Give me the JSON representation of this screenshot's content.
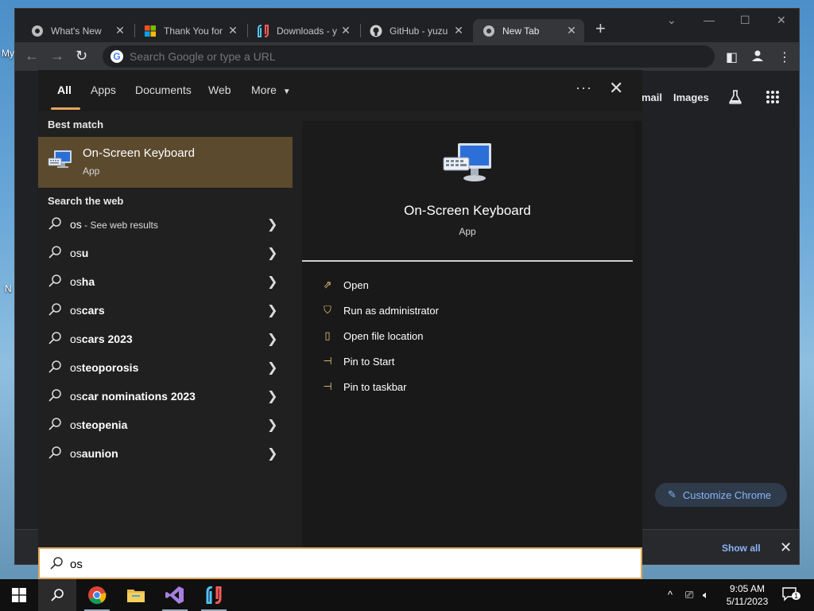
{
  "desktop": {
    "left_glyphs": [
      "My",
      "N"
    ]
  },
  "browser": {
    "tabs": [
      {
        "title": "What's New",
        "icon": "chrome-icon"
      },
      {
        "title": "Thank You for",
        "icon": "microsoft-icon"
      },
      {
        "title": "Downloads - y",
        "icon": "yuzu-icon"
      },
      {
        "title": "GitHub - yuzu",
        "icon": "github-icon"
      },
      {
        "title": "New Tab",
        "icon": "chrome-icon",
        "active": true
      }
    ],
    "new_tab_glyph": "+",
    "omnibox_placeholder": "Search Google or type a URL",
    "ntp": {
      "gmail": "mail",
      "images": "Images",
      "customize": "Customize Chrome"
    },
    "downloads_bar": {
      "show_all": "Show all"
    }
  },
  "search": {
    "filters": [
      "All",
      "Apps",
      "Documents",
      "Web",
      "More"
    ],
    "active_filter": "All",
    "best_match_label": "Best match",
    "best_match": {
      "title": "On-Screen Keyboard",
      "subtitle": "App"
    },
    "web_label": "Search the web",
    "web_results": [
      {
        "typed": "os",
        "rest": "",
        "hint": " - See web results"
      },
      {
        "typed": "os",
        "rest": "u",
        "hint": ""
      },
      {
        "typed": "os",
        "rest": "ha",
        "hint": ""
      },
      {
        "typed": "os",
        "rest": "cars",
        "hint": ""
      },
      {
        "typed": "os",
        "rest": "cars 2023",
        "hint": ""
      },
      {
        "typed": "os",
        "rest": "teoporosis",
        "hint": ""
      },
      {
        "typed": "os",
        "rest": "car nominations 2023",
        "hint": ""
      },
      {
        "typed": "os",
        "rest": "teopenia",
        "hint": ""
      },
      {
        "typed": "os",
        "rest": "aunion",
        "hint": ""
      }
    ],
    "detail": {
      "title": "On-Screen Keyboard",
      "subtitle": "App",
      "actions": [
        {
          "label": "Open",
          "icon": "open-icon"
        },
        {
          "label": "Run as administrator",
          "icon": "shield-icon"
        },
        {
          "label": "Open file location",
          "icon": "file-location-icon"
        },
        {
          "label": "Pin to Start",
          "icon": "pin-icon"
        },
        {
          "label": "Pin to taskbar",
          "icon": "pin-icon"
        }
      ]
    },
    "query": "os"
  },
  "taskbar": {
    "clock_time": "9:05 AM",
    "clock_date": "5/11/2023",
    "notification_count": "1"
  },
  "colors": {
    "accent": "#e0a95a",
    "best_match_bg": "#5b4a2e",
    "chrome_bg": "#202124",
    "link_blue": "#8ab4f8"
  }
}
